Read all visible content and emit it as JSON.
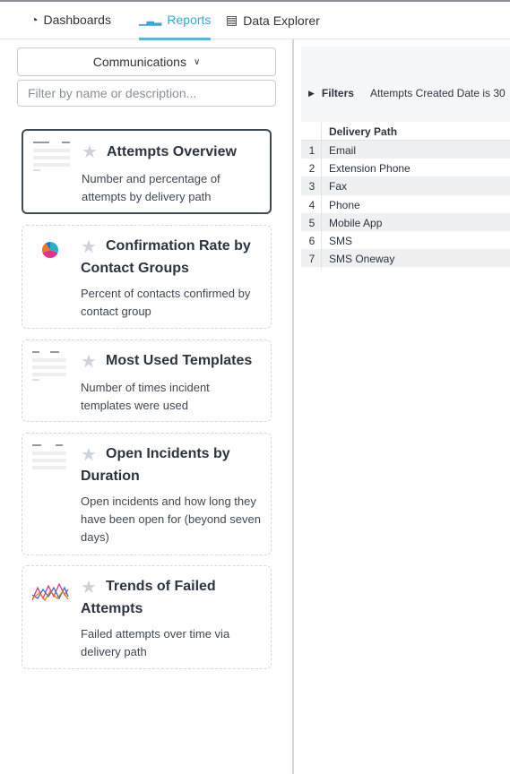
{
  "tabs": [
    {
      "label": "Dashboards",
      "icon": "gauge-icon"
    },
    {
      "label": "Reports",
      "icon": "bar-chart-icon",
      "active": true
    },
    {
      "label": "Data Explorer",
      "icon": "table-icon"
    }
  ],
  "sidebar": {
    "category": "Communications",
    "search_placeholder": "Filter by name or description...",
    "reports": [
      {
        "title": "Attempts Overview",
        "description": "Number and percentage of attempts by delivery path",
        "selected": true
      },
      {
        "title": "Confirmation Rate by Contact Groups",
        "description": "Percent of contacts confirmed by contact group"
      },
      {
        "title": "Most Used Templates",
        "description": "Number of times incident templates were used"
      },
      {
        "title": "Open Incidents by Duration",
        "description": "Open incidents and how long they have been open for (beyond seven days)"
      },
      {
        "title": "Trends of Failed Attempts",
        "description": "Failed attempts over time via delivery path"
      }
    ]
  },
  "main": {
    "filters_label": "Filters",
    "filter_text": "Attempts Created Date is 30",
    "table": {
      "column": "Delivery Path",
      "rows": [
        [
          "1",
          "Email"
        ],
        [
          "2",
          "Extension Phone"
        ],
        [
          "3",
          "Fax"
        ],
        [
          "4",
          "Phone"
        ],
        [
          "5",
          "Mobile App"
        ],
        [
          "6",
          "SMS"
        ],
        [
          "7",
          "SMS Oneway"
        ]
      ]
    }
  },
  "colors": {
    "accent": "#3aa5d6"
  }
}
